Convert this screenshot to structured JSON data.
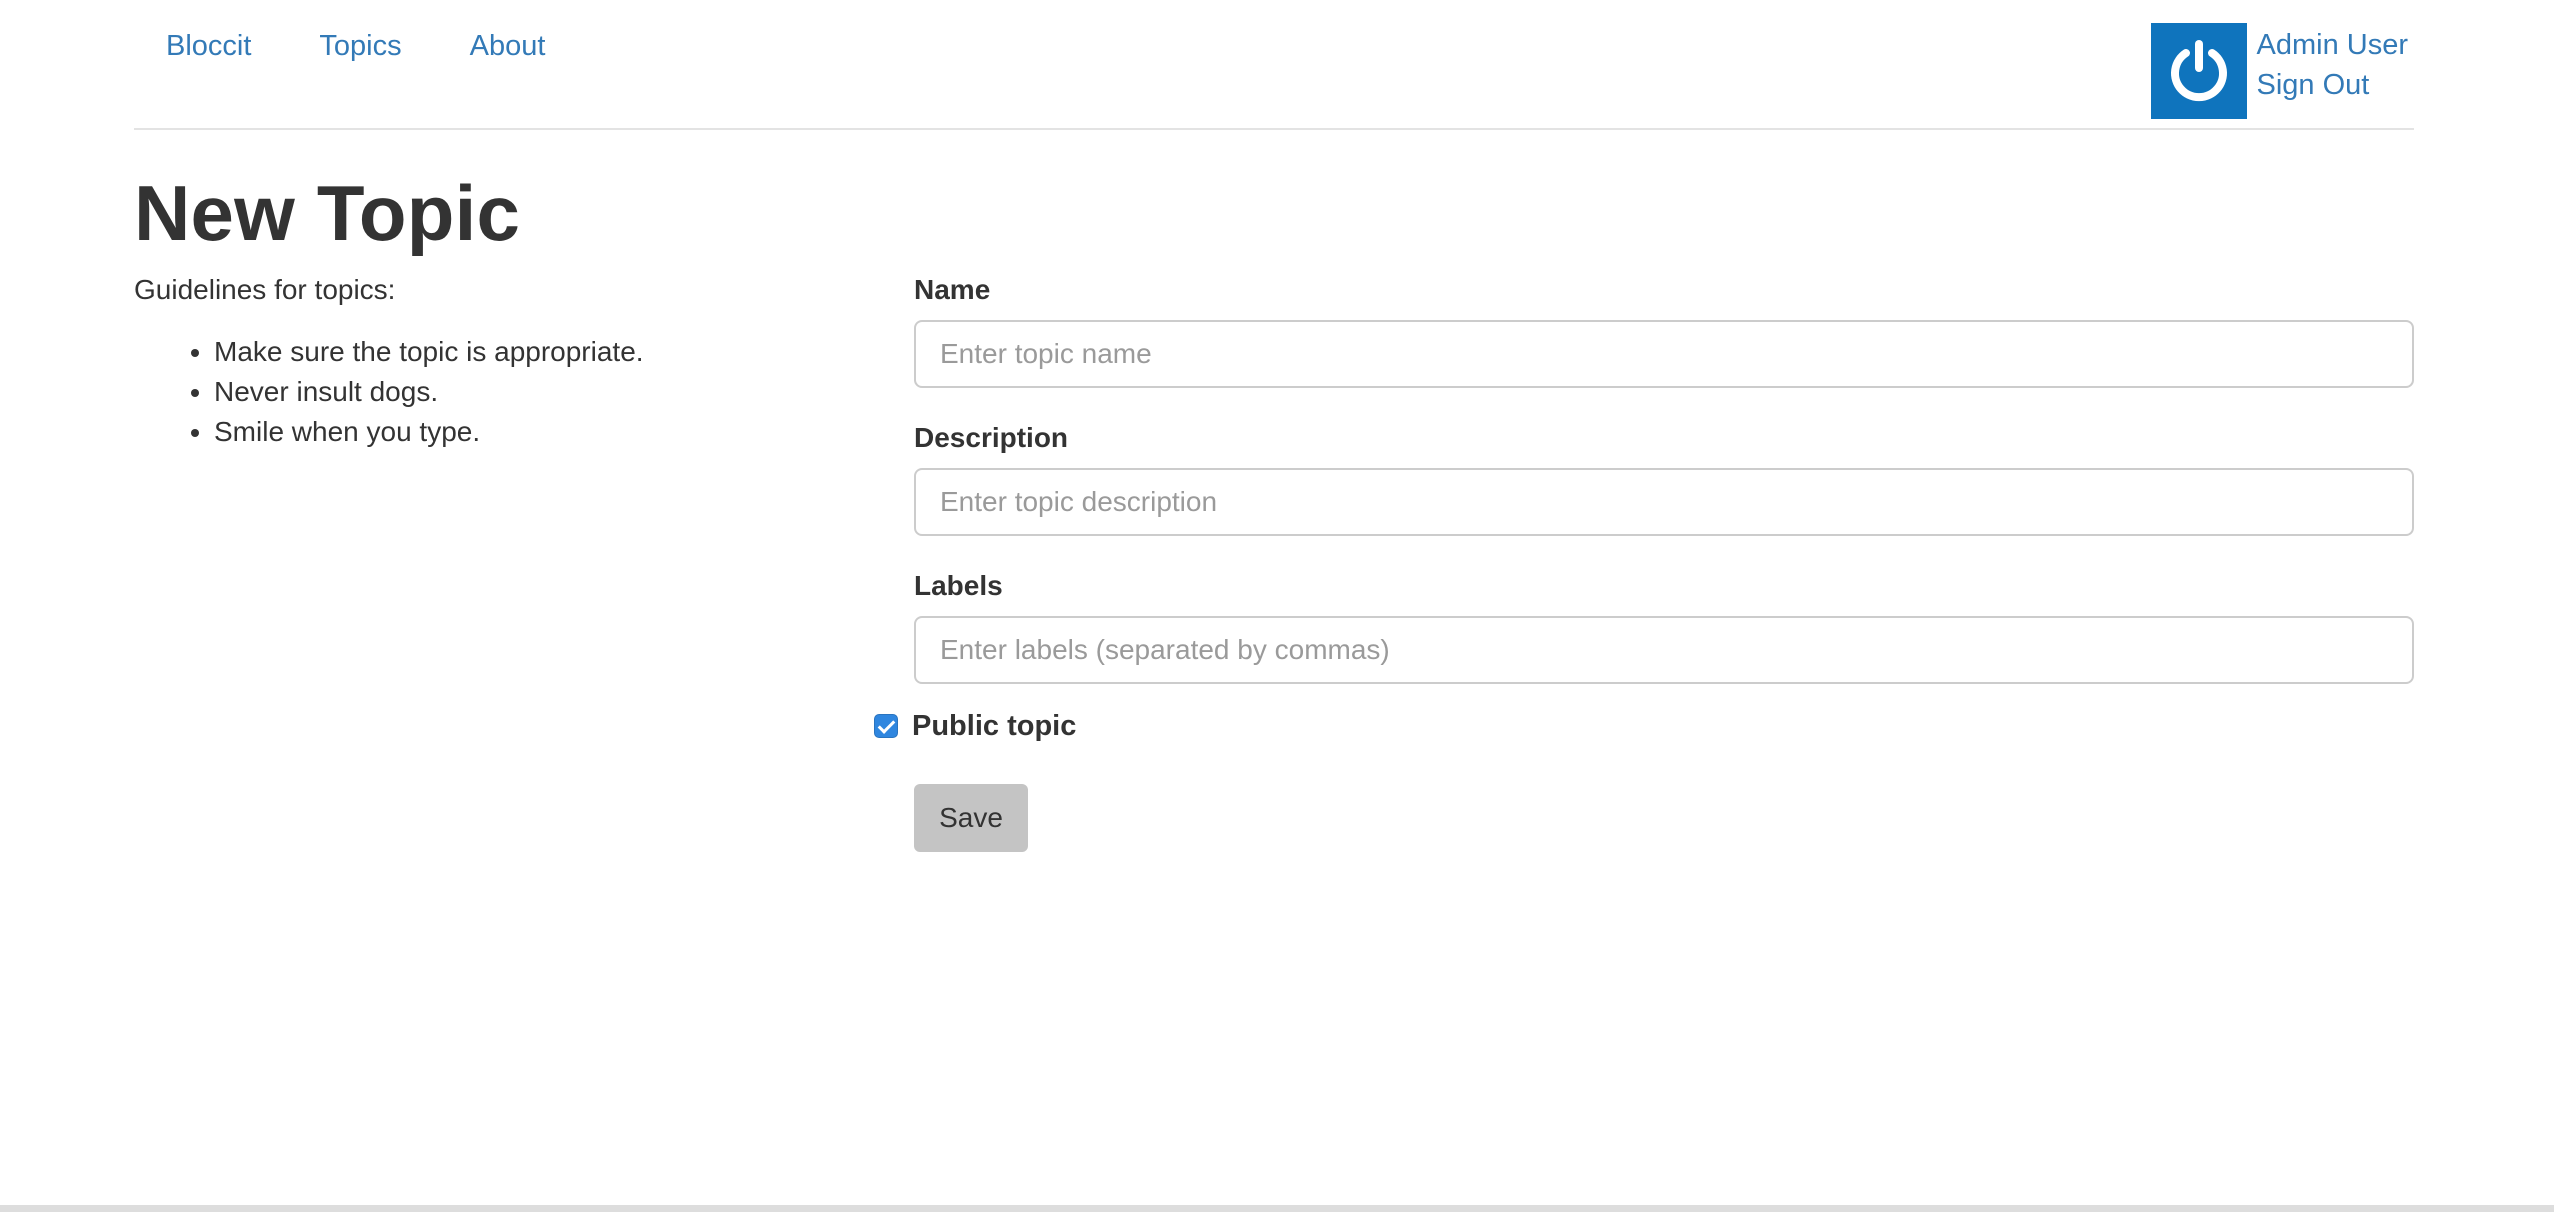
{
  "nav": {
    "links": [
      "Bloccit",
      "Topics",
      "About"
    ]
  },
  "user": {
    "name": "Admin User",
    "signout": "Sign Out"
  },
  "page": {
    "title": "New Topic"
  },
  "guidelines": {
    "intro": "Guidelines for topics:",
    "items": [
      "Make sure the topic is appropriate.",
      "Never insult dogs.",
      "Smile when you type."
    ]
  },
  "form": {
    "name_label": "Name",
    "name_placeholder": "Enter topic name",
    "description_label": "Description",
    "description_placeholder": "Enter topic description",
    "labels_label": "Labels",
    "labels_placeholder": "Enter labels (separated by commas)",
    "public_label": "Public topic",
    "save_label": "Save"
  },
  "colors": {
    "link": "#337ab7",
    "avatar": "#0f74bd",
    "checkbox": "#2f86df",
    "button": "#c4c4c4"
  },
  "icons": {
    "avatar": "power-icon",
    "checkbox": "checkmark-icon"
  }
}
